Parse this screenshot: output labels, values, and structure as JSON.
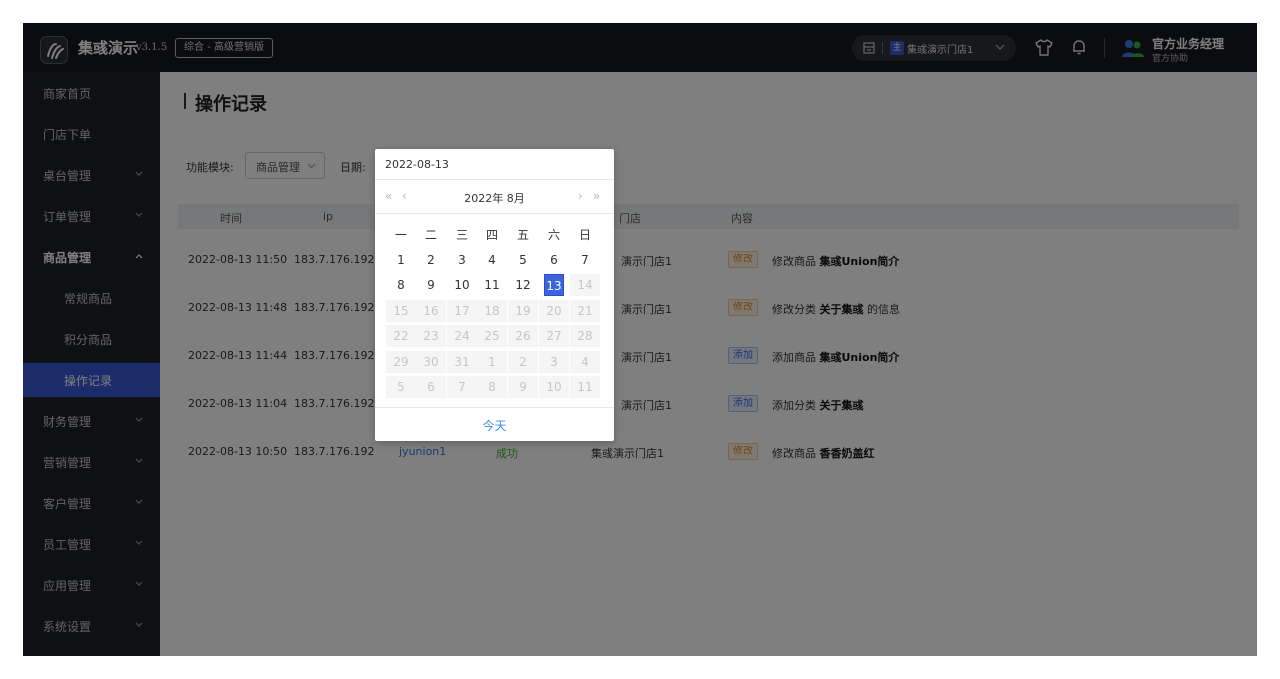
{
  "header": {
    "brand_name": "集彧演示",
    "version": "v3.1.5",
    "edition": "综合 - 高级营销版",
    "store_tag": "主",
    "store_name": "集彧演示门店1",
    "user_name": "官方业务经理",
    "user_role": "官方协助"
  },
  "sidebar": {
    "items": [
      {
        "label": "商家首页",
        "has_arrow": false
      },
      {
        "label": "门店下单",
        "has_arrow": false
      },
      {
        "label": "桌台管理",
        "has_arrow": true
      },
      {
        "label": "订单管理",
        "has_arrow": true
      },
      {
        "label": "商品管理",
        "has_arrow": true,
        "open": true
      },
      {
        "label": "常规商品",
        "sub": true
      },
      {
        "label": "积分商品",
        "sub": true
      },
      {
        "label": "操作记录",
        "sub": true,
        "active": true
      },
      {
        "label": "财务管理",
        "has_arrow": true
      },
      {
        "label": "营销管理",
        "has_arrow": true
      },
      {
        "label": "客户管理",
        "has_arrow": true
      },
      {
        "label": "员工管理",
        "has_arrow": true
      },
      {
        "label": "应用管理",
        "has_arrow": true
      },
      {
        "label": "系统设置",
        "has_arrow": true
      }
    ]
  },
  "main": {
    "title": "操作记录",
    "filter": {
      "module_label": "功能模块:",
      "module_value": "商品管理",
      "date_label": "日期:"
    },
    "table": {
      "headers": [
        "时间",
        "ip",
        "门店",
        "内容"
      ],
      "rows": [
        {
          "time": "2022-08-13 11:50",
          "ip": "183.7.176.192",
          "user": "",
          "status": "",
          "store": "演示门店1",
          "tag": "修改",
          "tag_type": "edit",
          "action": "修改商品",
          "target": "集彧Union简介",
          "suffix": ""
        },
        {
          "time": "2022-08-13 11:48",
          "ip": "183.7.176.192",
          "user": "",
          "status": "",
          "store": "演示门店1",
          "tag": "修改",
          "tag_type": "edit",
          "action": "修改分类",
          "target": "关于集彧",
          "suffix": "的信息"
        },
        {
          "time": "2022-08-13 11:44",
          "ip": "183.7.176.192",
          "user": "",
          "status": "",
          "store": "演示门店1",
          "tag": "添加",
          "tag_type": "add",
          "action": "添加商品",
          "target": "集彧Union简介",
          "suffix": ""
        },
        {
          "time": "2022-08-13 11:04",
          "ip": "183.7.176.192",
          "user": "",
          "status": "",
          "store": "演示门店1",
          "tag": "添加",
          "tag_type": "add",
          "action": "添加分类",
          "target": "关于集彧",
          "suffix": ""
        },
        {
          "time": "2022-08-13 10:50",
          "ip": "183.7.176.192",
          "user": "jyunion1",
          "status": "成功",
          "store": "集彧演示门店1",
          "tag": "修改",
          "tag_type": "edit",
          "action": "修改商品",
          "target": "香香奶盖红",
          "suffix": ""
        }
      ]
    }
  },
  "datepicker": {
    "value": "2022-08-13",
    "title": "2022年 8月",
    "prev_year": "«",
    "prev_month": "‹",
    "next_month": "›",
    "next_year": "»",
    "weekdays": [
      "一",
      "二",
      "三",
      "四",
      "五",
      "六",
      "日"
    ],
    "weeks": [
      [
        1,
        2,
        3,
        4,
        5,
        6,
        7
      ],
      [
        8,
        9,
        10,
        11,
        12,
        13,
        14
      ],
      [
        15,
        16,
        17,
        18,
        19,
        20,
        21
      ],
      [
        22,
        23,
        24,
        25,
        26,
        27,
        28
      ],
      [
        29,
        30,
        31,
        1,
        2,
        3,
        4
      ],
      [
        5,
        6,
        7,
        8,
        9,
        10,
        11
      ]
    ],
    "selected_day": 13,
    "last_enabled_day": 13,
    "today_label": "今天"
  }
}
